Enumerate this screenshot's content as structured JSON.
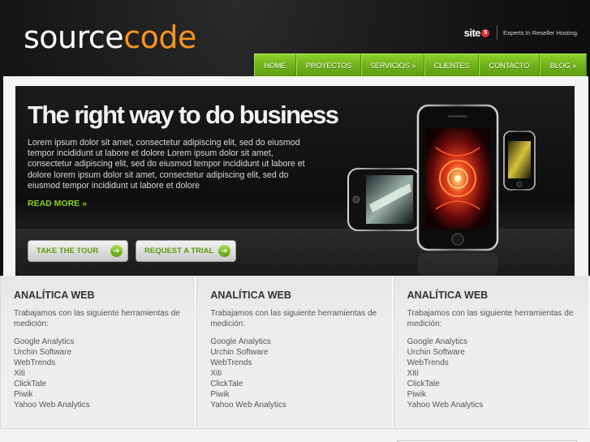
{
  "header": {
    "logo_part1": "source",
    "logo_part2": "code",
    "partner_logo": "site",
    "partner_logo_mark": "5",
    "partner_tagline": "Experts In Reseller Hosting."
  },
  "nav": {
    "items": [
      {
        "label": "HOME"
      },
      {
        "label": "PROYECTOS"
      },
      {
        "label": "SERVICIOS »"
      },
      {
        "label": "CLIENTES"
      },
      {
        "label": "CONTACTO"
      },
      {
        "label": "BLOG »"
      }
    ]
  },
  "hero": {
    "title": "The right way to do business",
    "text": "Lorem ipsum dolor sit amet, consectetur adipiscing elit, sed do eiusmod tempor incididunt ut labore et dolore Lorem ipsum dolor sit amet, consectetur adipiscing elit, sed do eiusmod tempor incididunt ut labore et dolore lorem ipsum dolor sit amet, consectetur adipiscing elit, sed do eiusmod tempor incididunt ut labore et dolore",
    "read_more": "READ MORE »",
    "button1": "TAKE THE TOUR",
    "button2": "REQUEST A TRIAL"
  },
  "columns": [
    {
      "title": "ANALÍTICA WEB",
      "intro": "Trabajamos con las siguiente herramientas de medición:",
      "items": [
        "Google Analytics",
        "Urchin Software",
        "WebTrends",
        "Xiti",
        "ClickTale",
        "Piwik",
        "Yahoo Web Analytics"
      ]
    },
    {
      "title": "ANALÍTICA WEB",
      "intro": "Trabajamos con las siguiente herramientas de medición:",
      "items": [
        "Google Analytics",
        "Urchin Software",
        "WebTrends",
        "Xiti",
        "ClickTale",
        "Piwik",
        "Yahoo Web Analytics"
      ]
    },
    {
      "title": "ANALÍTICA WEB",
      "intro": "Trabajamos con las siguiente herramientas de medición:",
      "items": [
        "Google Analytics",
        "Urchin Software",
        "WebTrends",
        "Xiti",
        "ClickTale",
        "Piwik",
        "Yahoo Web Analytics"
      ]
    }
  ],
  "colors": {
    "brand_orange": "#f7941d",
    "nav_green": "#6fb31a",
    "accent_green": "#8dd11f"
  }
}
